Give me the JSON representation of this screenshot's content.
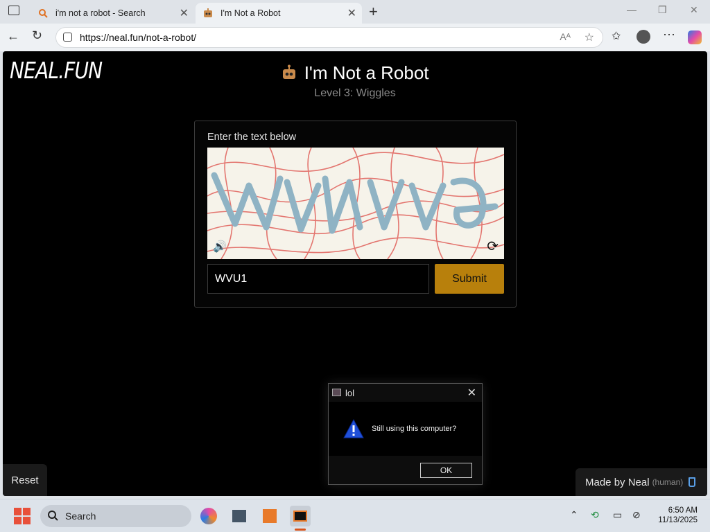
{
  "browser": {
    "tabs": [
      {
        "title": "i'm not a robot - Search",
        "active": false
      },
      {
        "title": "I'm Not a Robot",
        "active": true
      }
    ],
    "url": "https://neal.fun/not-a-robot/"
  },
  "page": {
    "logo": "NEAL.FUN",
    "title": "I'm Not a Robot",
    "subtitle": "Level 3: Wiggles",
    "card_label": "Enter the text below",
    "input_value": "WVU1",
    "submit_label": "Submit",
    "reset_label": "Reset",
    "made_by": "Made by Neal",
    "human": "(human)"
  },
  "dialog": {
    "title": "lol",
    "message": "Still using this computer?",
    "ok_label": "OK"
  },
  "taskbar": {
    "search_label": "Search",
    "time": "6:50 AM",
    "date": "11/13/2025"
  },
  "colors": {
    "accent": "#b8800c",
    "captcha_text": "#8fb3c4",
    "captcha_lines": "#e0605a"
  }
}
